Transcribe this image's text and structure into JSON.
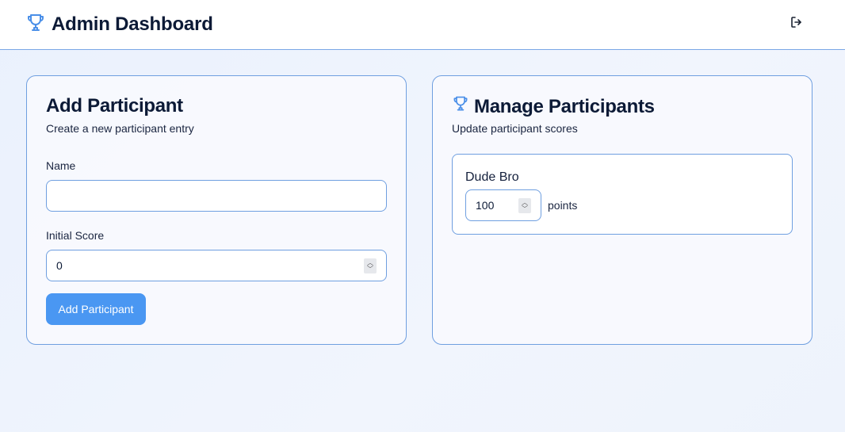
{
  "header": {
    "title": "Admin Dashboard",
    "logo_icon": "trophy-icon",
    "logout_icon": "logout-icon"
  },
  "add_card": {
    "title": "Add Participant",
    "subtitle": "Create a new participant entry",
    "name_label": "Name",
    "name_value": "",
    "score_label": "Initial Score",
    "score_value": "0",
    "button_label": "Add Participant"
  },
  "manage_card": {
    "title": "Manage Participants",
    "subtitle": "Update participant scores",
    "title_icon": "trophy-icon",
    "participants": [
      {
        "name": "Dude Bro",
        "score": "100",
        "unit": "points"
      }
    ]
  },
  "colors": {
    "accent": "#4a97f2",
    "border": "#6f9fe0",
    "text": "#0c1a36"
  }
}
